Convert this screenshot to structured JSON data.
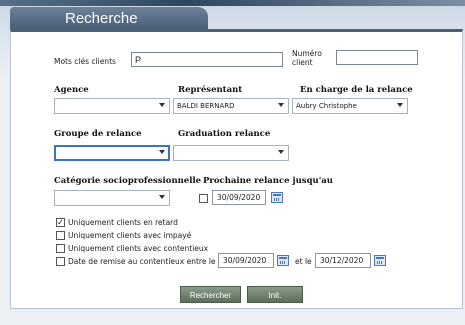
{
  "tab": {
    "title": "Recherche"
  },
  "search": {
    "keywords_label": "Mots clés clients",
    "keywords_value": "P",
    "number_label_line1": "Numéro",
    "number_label_line2": "client",
    "number_value": ""
  },
  "filters": {
    "agence_label": "Agence",
    "agence_value": "",
    "representant_label": "Représentant",
    "representant_value": "BALDI BERNARD",
    "relance_label": "En charge de la relance",
    "relance_value": "Aubry Christophe",
    "groupe_label": "Groupe de relance",
    "groupe_value": "",
    "graduation_label": "Graduation relance",
    "graduation_value": "",
    "categorie_label": "Catégorie socioprofessionnelle",
    "categorie_value": "",
    "prochaine_label": "Prochaine relance jusqu'au",
    "prochaine_date": "30/09/2020",
    "prochaine_checked": false
  },
  "options": {
    "retard_label": "Uniquement clients en retard",
    "retard_checked": true,
    "impaye_label": "Uniquement clients avec impayé",
    "impaye_checked": false,
    "contentieux_label": "Uniquement clients avec contentieux",
    "contentieux_checked": false,
    "date_remise_label": "Date de remise au contentieux entre le",
    "date_remise_checked": false,
    "date_from": "30/09/2020",
    "date_sep": "et le",
    "date_to": "30/12/2020"
  },
  "buttons": {
    "search_label": "Rechercher",
    "reset_label": "Init."
  },
  "icons": {
    "calendar": "calendar-icon",
    "dropdown": "chevron-down-icon"
  }
}
